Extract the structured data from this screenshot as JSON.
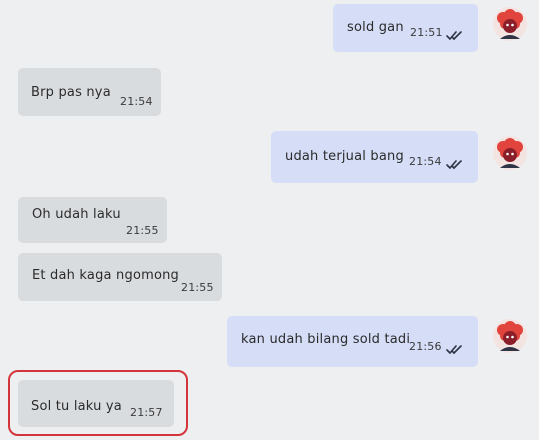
{
  "messages": [
    {
      "direction": "outgoing",
      "text": "sold gan",
      "time": "21:51",
      "status": "read"
    },
    {
      "direction": "incoming",
      "text": "Brp pas nya",
      "time": "21:54"
    },
    {
      "direction": "outgoing",
      "text": "udah terjual bang",
      "time": "21:54",
      "status": "read"
    },
    {
      "direction": "incoming",
      "text": "Oh udah laku",
      "time": "21:55"
    },
    {
      "direction": "incoming",
      "text": "Et dah kaga ngomong",
      "time": "21:55"
    },
    {
      "direction": "outgoing",
      "text": "kan udah bilang sold tadi",
      "time": "21:56",
      "status": "read"
    },
    {
      "direction": "incoming",
      "text": "Sol tu laku ya",
      "time": "21:57",
      "highlighted": true
    }
  ],
  "colors": {
    "background": "#eeeff1",
    "incoming_bubble": "#d9dcdf",
    "outgoing_bubble": "#d5ddf7",
    "highlight": "#d3353b",
    "avatar": "#e0443c"
  },
  "icons": {
    "read_status": "double-check-icon",
    "avatar": "user-avatar-icon"
  }
}
